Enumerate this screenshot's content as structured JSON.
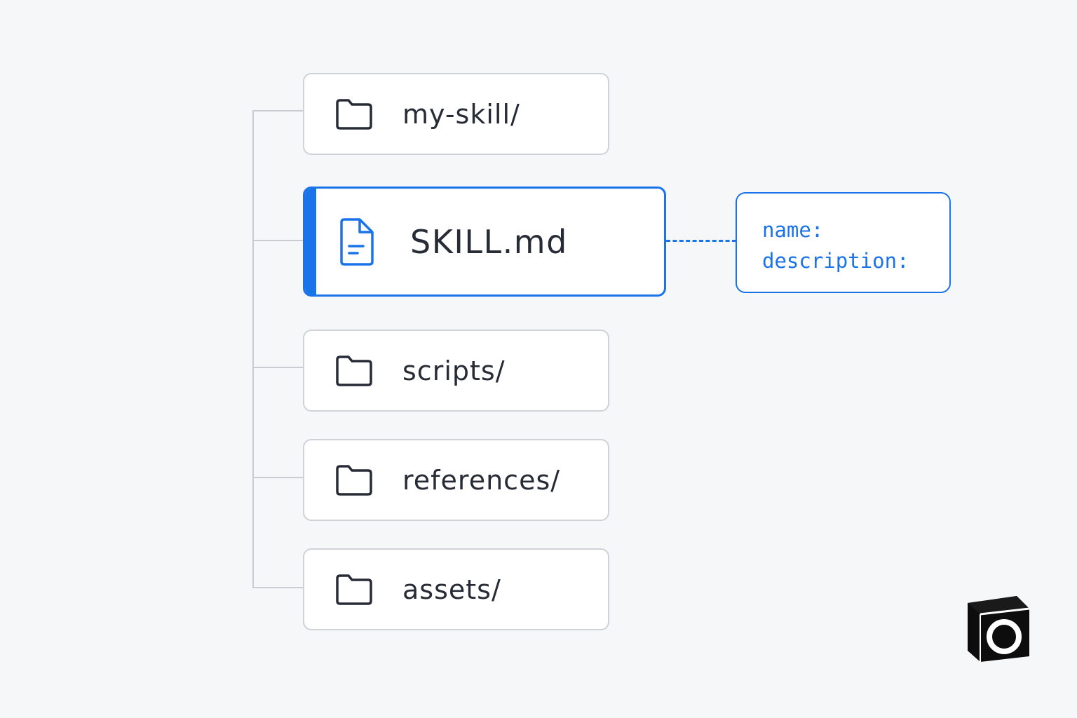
{
  "tree": {
    "items": [
      {
        "label": "my-skill/",
        "icon": "folder-icon"
      },
      {
        "label": "SKILL.md",
        "icon": "document-icon",
        "selected": true
      },
      {
        "label": "scripts/",
        "icon": "folder-icon"
      },
      {
        "label": "references/",
        "icon": "folder-icon"
      },
      {
        "label": "assets/",
        "icon": "folder-icon"
      }
    ]
  },
  "frontmatter": {
    "fields": [
      "name:",
      "description:"
    ]
  },
  "colors": {
    "accent": "#1a73e8",
    "text": "#262b36",
    "border": "#cfd2d7",
    "background": "#f6f7f9"
  },
  "logo": {
    "icon": "cube-logo-icon"
  }
}
